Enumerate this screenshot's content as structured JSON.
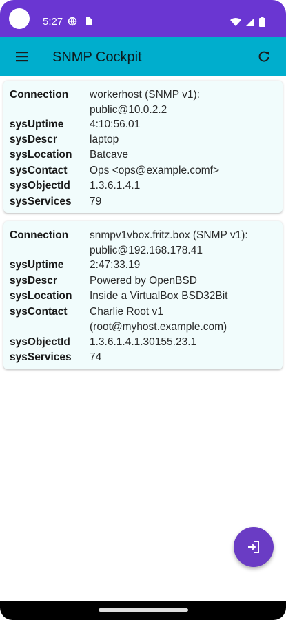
{
  "status_bar": {
    "time": "5:27",
    "colors": {
      "background": "#6a36d2"
    },
    "icons": [
      "camera-cutout",
      "vpn-globe-icon",
      "sim-card-icon",
      "wifi-icon",
      "cellular-icon",
      "battery-icon"
    ]
  },
  "app_bar": {
    "title": "SNMP Cockpit",
    "menu_icon": "menu-icon",
    "refresh_icon": "refresh-icon",
    "colors": {
      "background": "#00aecd"
    }
  },
  "cards": [
    {
      "rows": [
        {
          "label": "Connection",
          "value": "workerhost (SNMP v1): public@10.0.2.2"
        },
        {
          "label": "sysUptime",
          "value": "4:10:56.01"
        },
        {
          "label": "sysDescr",
          "value": "laptop"
        },
        {
          "label": "sysLocation",
          "value": "Batcave"
        },
        {
          "label": "sysContact",
          "value": "Ops <ops@example.comf>"
        },
        {
          "label": "sysObjectId",
          "value": "1.3.6.1.4.1"
        },
        {
          "label": "sysServices",
          "value": "79"
        }
      ]
    },
    {
      "rows": [
        {
          "label": "Connection",
          "value": "snmpv1vbox.fritz.box (SNMP v1): public@192.168.178.41"
        },
        {
          "label": "sysUptime",
          "value": "2:47:33.19"
        },
        {
          "label": "sysDescr",
          "value": "Powered by OpenBSD"
        },
        {
          "label": "sysLocation",
          "value": "Inside a VirtualBox BSD32Bit"
        },
        {
          "label": "sysContact",
          "value": "Charlie Root v1 (root@myhost.example.com)"
        },
        {
          "label": "sysObjectId",
          "value": "1.3.6.1.4.1.30155.23.1"
        },
        {
          "label": "sysServices",
          "value": "74"
        }
      ]
    }
  ],
  "fab": {
    "icon": "login-icon",
    "colors": {
      "background": "#6a3cc4"
    }
  },
  "colors": {
    "card_background": "#f1fcfc"
  }
}
